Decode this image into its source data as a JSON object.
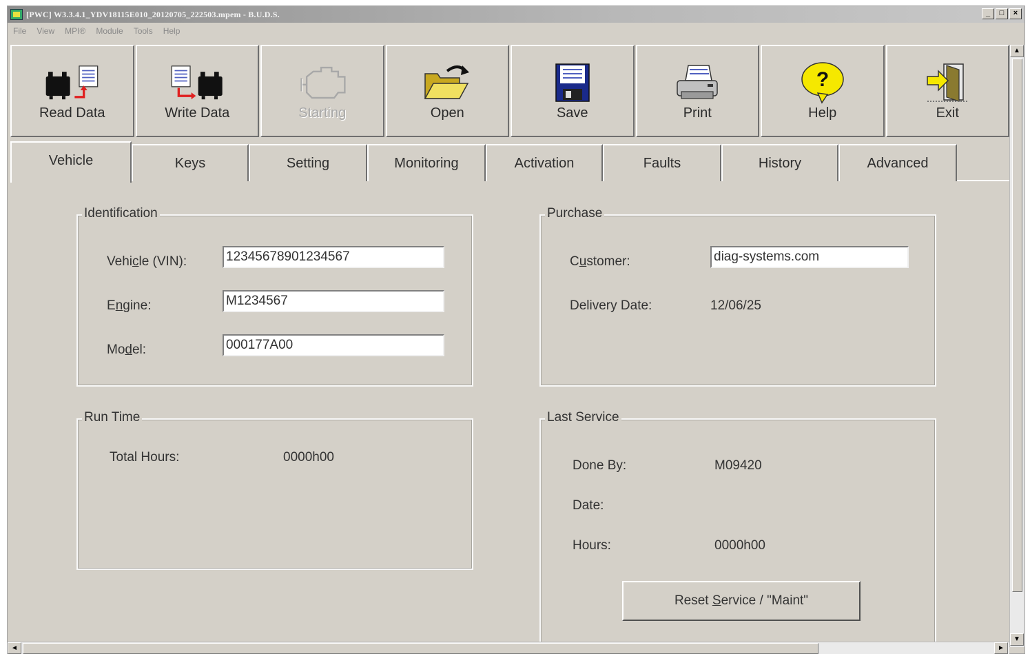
{
  "window": {
    "title": "[PWC] W3.3.4.1_YDV18115E010_20120705_222503.mpem - B.U.D.S.",
    "controls": [
      "_",
      "□",
      "×"
    ]
  },
  "menu": [
    "File",
    "View",
    "MPI®",
    "Module",
    "Tools",
    "Help"
  ],
  "toolbar": [
    {
      "label": "Read Data",
      "icon": "read-data-icon",
      "enabled": true
    },
    {
      "label": "Write Data",
      "icon": "write-data-icon",
      "enabled": true
    },
    {
      "label": "Starting",
      "icon": "engine-icon",
      "enabled": false
    },
    {
      "label": "Open",
      "icon": "open-folder-icon",
      "enabled": true
    },
    {
      "label": "Save",
      "icon": "floppy-disk-icon",
      "enabled": true
    },
    {
      "label": "Print",
      "icon": "printer-icon",
      "enabled": true
    },
    {
      "label": "Help",
      "icon": "help-bubble-icon",
      "enabled": true
    },
    {
      "label": "Exit",
      "icon": "exit-door-icon",
      "enabled": true
    }
  ],
  "tabs": [
    "Vehicle",
    "Keys",
    "Setting",
    "Monitoring",
    "Activation",
    "Faults",
    "History",
    "Advanced"
  ],
  "active_tab": "Vehicle",
  "identification": {
    "title": "Identification",
    "vin_label_pre": "Vehi",
    "vin_label_u": "c",
    "vin_label_post": "le (VIN):",
    "vin_value": "12345678901234567",
    "engine_label_pre": "E",
    "engine_label_u": "n",
    "engine_label_post": "gine:",
    "engine_value": "M1234567",
    "model_label_pre": "Mo",
    "model_label_u": "d",
    "model_label_post": "el:",
    "model_value": "000177A00"
  },
  "purchase": {
    "title": "Purchase",
    "customer_label_pre": "C",
    "customer_label_u": "u",
    "customer_label_post": "stomer:",
    "customer_value": "diag-systems.com",
    "delivery_label": "Delivery Date:",
    "delivery_value": "12/06/25"
  },
  "run_time": {
    "title": "Run Time",
    "total_hours_label": "Total Hours:",
    "total_hours_value": "0000h00"
  },
  "last_service": {
    "title": "Last Service",
    "done_by_label": "Done By:",
    "done_by_value": "M09420",
    "date_label": "Date:",
    "date_value": "",
    "hours_label": "Hours:",
    "hours_value": "0000h00",
    "reset_pre": "Reset ",
    "reset_u": "S",
    "reset_post": "ervice / \"Maint\""
  },
  "colors": {
    "face": "#d4d0c8",
    "titlebar": "#8c8c8c"
  }
}
